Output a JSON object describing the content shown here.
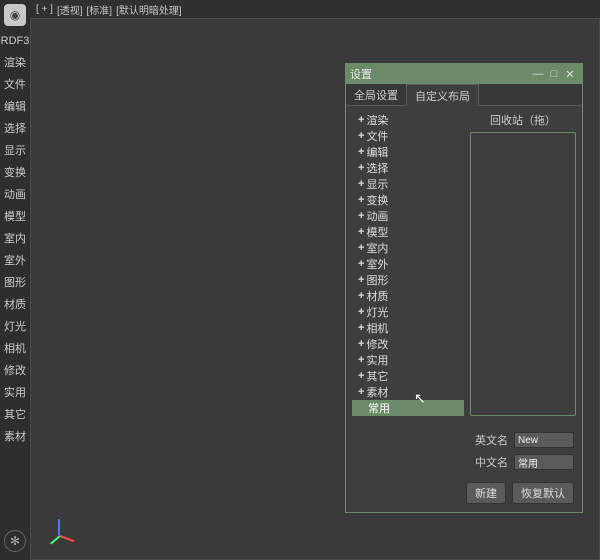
{
  "sidebar": {
    "items": [
      {
        "label": "RDF3"
      },
      {
        "label": "渲染"
      },
      {
        "label": "文件"
      },
      {
        "label": "编辑"
      },
      {
        "label": "选择"
      },
      {
        "label": "显示"
      },
      {
        "label": "变换"
      },
      {
        "label": "动画"
      },
      {
        "label": "模型"
      },
      {
        "label": "室内"
      },
      {
        "label": "室外"
      },
      {
        "label": "图形"
      },
      {
        "label": "材质"
      },
      {
        "label": "灯光"
      },
      {
        "label": "相机"
      },
      {
        "label": "修改"
      },
      {
        "label": "实用"
      },
      {
        "label": "其它"
      },
      {
        "label": "素材"
      }
    ]
  },
  "topbar": {
    "tags": [
      "[ + ]",
      "[透视]",
      "[标准]",
      "[默认明暗处理]"
    ]
  },
  "dialog": {
    "title": "设置",
    "tabs": {
      "global": "全局设置",
      "custom": "自定义布局"
    },
    "tree": [
      {
        "label": "渲染"
      },
      {
        "label": "文件"
      },
      {
        "label": "编辑"
      },
      {
        "label": "选择"
      },
      {
        "label": "显示"
      },
      {
        "label": "变换"
      },
      {
        "label": "动画"
      },
      {
        "label": "模型"
      },
      {
        "label": "室内"
      },
      {
        "label": "室外"
      },
      {
        "label": "图形"
      },
      {
        "label": "材质"
      },
      {
        "label": "灯光"
      },
      {
        "label": "相机"
      },
      {
        "label": "修改"
      },
      {
        "label": "实用"
      },
      {
        "label": "其它"
      },
      {
        "label": "素材"
      }
    ],
    "selected": "常用",
    "recycle_label": "回收站（拖）",
    "en_label": "英文名",
    "en_value": "New",
    "zh_label": "中文名",
    "zh_value": "常用",
    "btn_new": "新建",
    "btn_reset": "恢复默认"
  }
}
